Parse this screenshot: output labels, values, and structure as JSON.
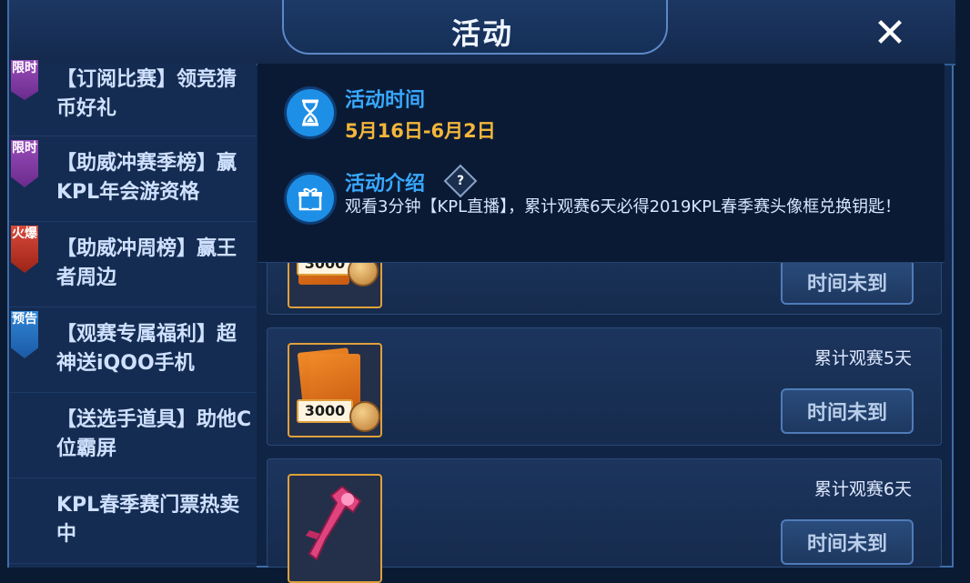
{
  "window": {
    "title": "活动"
  },
  "sidebar": {
    "items": [
      {
        "badge": "限时",
        "badge_color": "#8a3fae",
        "label": "【订阅比赛】领竞猜币好礼"
      },
      {
        "badge": "限时",
        "badge_color": "#8a3fae",
        "label": "【助威冲赛季榜】赢KPL年会游资格"
      },
      {
        "badge": "火爆",
        "badge_color": "#c3382a",
        "label": "【助威冲周榜】赢王者周边"
      },
      {
        "badge": "预告",
        "badge_color": "#2577c9",
        "label": "【观赛专属福利】超神送iQOO手机"
      },
      {
        "badge": "",
        "badge_color": "",
        "label": "【送选手道具】助他C位霸屏"
      },
      {
        "badge": "",
        "badge_color": "",
        "label": "KPL春季赛门票热卖中"
      }
    ]
  },
  "info": {
    "time_label": "活动时间",
    "time_value": "5月16日-6月2日",
    "intro_label": "活动介绍",
    "help_icon": "?",
    "intro_text": "观看3分钟【KPL直播】，累计观赛6天必得2019KPL春季赛头像框兑换钥匙！"
  },
  "rewards": [
    {
      "label": "",
      "item": "3000",
      "button": "时间未到"
    },
    {
      "label": "累计观赛5天",
      "item": "3000",
      "button": "时间未到"
    },
    {
      "label": "累计观赛6天",
      "item": "",
      "button": "时间未到"
    }
  ],
  "colors": {
    "accent_blue": "#38a8ff",
    "time_gold": "#f3b63b",
    "item_border": "#e0a03a"
  }
}
